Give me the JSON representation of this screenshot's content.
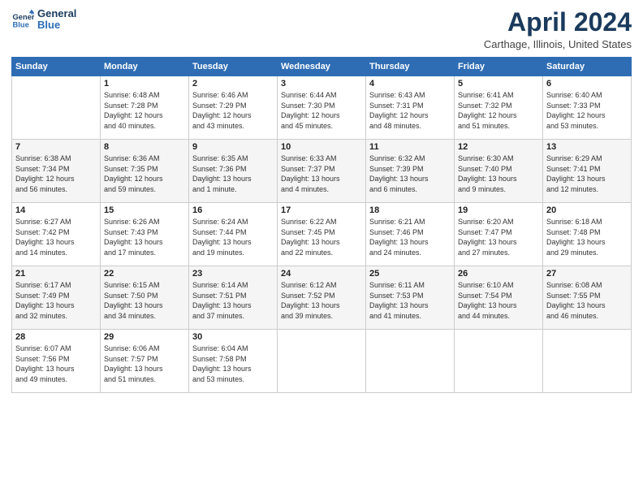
{
  "header": {
    "logo_line1": "General",
    "logo_line2": "Blue",
    "title": "April 2024",
    "subtitle": "Carthage, Illinois, United States"
  },
  "columns": [
    "Sunday",
    "Monday",
    "Tuesday",
    "Wednesday",
    "Thursday",
    "Friday",
    "Saturday"
  ],
  "weeks": [
    [
      {
        "day": "",
        "info": ""
      },
      {
        "day": "1",
        "info": "Sunrise: 6:48 AM\nSunset: 7:28 PM\nDaylight: 12 hours\nand 40 minutes."
      },
      {
        "day": "2",
        "info": "Sunrise: 6:46 AM\nSunset: 7:29 PM\nDaylight: 12 hours\nand 43 minutes."
      },
      {
        "day": "3",
        "info": "Sunrise: 6:44 AM\nSunset: 7:30 PM\nDaylight: 12 hours\nand 45 minutes."
      },
      {
        "day": "4",
        "info": "Sunrise: 6:43 AM\nSunset: 7:31 PM\nDaylight: 12 hours\nand 48 minutes."
      },
      {
        "day": "5",
        "info": "Sunrise: 6:41 AM\nSunset: 7:32 PM\nDaylight: 12 hours\nand 51 minutes."
      },
      {
        "day": "6",
        "info": "Sunrise: 6:40 AM\nSunset: 7:33 PM\nDaylight: 12 hours\nand 53 minutes."
      }
    ],
    [
      {
        "day": "7",
        "info": "Sunrise: 6:38 AM\nSunset: 7:34 PM\nDaylight: 12 hours\nand 56 minutes."
      },
      {
        "day": "8",
        "info": "Sunrise: 6:36 AM\nSunset: 7:35 PM\nDaylight: 12 hours\nand 59 minutes."
      },
      {
        "day": "9",
        "info": "Sunrise: 6:35 AM\nSunset: 7:36 PM\nDaylight: 13 hours\nand 1 minute."
      },
      {
        "day": "10",
        "info": "Sunrise: 6:33 AM\nSunset: 7:37 PM\nDaylight: 13 hours\nand 4 minutes."
      },
      {
        "day": "11",
        "info": "Sunrise: 6:32 AM\nSunset: 7:39 PM\nDaylight: 13 hours\nand 6 minutes."
      },
      {
        "day": "12",
        "info": "Sunrise: 6:30 AM\nSunset: 7:40 PM\nDaylight: 13 hours\nand 9 minutes."
      },
      {
        "day": "13",
        "info": "Sunrise: 6:29 AM\nSunset: 7:41 PM\nDaylight: 13 hours\nand 12 minutes."
      }
    ],
    [
      {
        "day": "14",
        "info": "Sunrise: 6:27 AM\nSunset: 7:42 PM\nDaylight: 13 hours\nand 14 minutes."
      },
      {
        "day": "15",
        "info": "Sunrise: 6:26 AM\nSunset: 7:43 PM\nDaylight: 13 hours\nand 17 minutes."
      },
      {
        "day": "16",
        "info": "Sunrise: 6:24 AM\nSunset: 7:44 PM\nDaylight: 13 hours\nand 19 minutes."
      },
      {
        "day": "17",
        "info": "Sunrise: 6:22 AM\nSunset: 7:45 PM\nDaylight: 13 hours\nand 22 minutes."
      },
      {
        "day": "18",
        "info": "Sunrise: 6:21 AM\nSunset: 7:46 PM\nDaylight: 13 hours\nand 24 minutes."
      },
      {
        "day": "19",
        "info": "Sunrise: 6:20 AM\nSunset: 7:47 PM\nDaylight: 13 hours\nand 27 minutes."
      },
      {
        "day": "20",
        "info": "Sunrise: 6:18 AM\nSunset: 7:48 PM\nDaylight: 13 hours\nand 29 minutes."
      }
    ],
    [
      {
        "day": "21",
        "info": "Sunrise: 6:17 AM\nSunset: 7:49 PM\nDaylight: 13 hours\nand 32 minutes."
      },
      {
        "day": "22",
        "info": "Sunrise: 6:15 AM\nSunset: 7:50 PM\nDaylight: 13 hours\nand 34 minutes."
      },
      {
        "day": "23",
        "info": "Sunrise: 6:14 AM\nSunset: 7:51 PM\nDaylight: 13 hours\nand 37 minutes."
      },
      {
        "day": "24",
        "info": "Sunrise: 6:12 AM\nSunset: 7:52 PM\nDaylight: 13 hours\nand 39 minutes."
      },
      {
        "day": "25",
        "info": "Sunrise: 6:11 AM\nSunset: 7:53 PM\nDaylight: 13 hours\nand 41 minutes."
      },
      {
        "day": "26",
        "info": "Sunrise: 6:10 AM\nSunset: 7:54 PM\nDaylight: 13 hours\nand 44 minutes."
      },
      {
        "day": "27",
        "info": "Sunrise: 6:08 AM\nSunset: 7:55 PM\nDaylight: 13 hours\nand 46 minutes."
      }
    ],
    [
      {
        "day": "28",
        "info": "Sunrise: 6:07 AM\nSunset: 7:56 PM\nDaylight: 13 hours\nand 49 minutes."
      },
      {
        "day": "29",
        "info": "Sunrise: 6:06 AM\nSunset: 7:57 PM\nDaylight: 13 hours\nand 51 minutes."
      },
      {
        "day": "30",
        "info": "Sunrise: 6:04 AM\nSunset: 7:58 PM\nDaylight: 13 hours\nand 53 minutes."
      },
      {
        "day": "",
        "info": ""
      },
      {
        "day": "",
        "info": ""
      },
      {
        "day": "",
        "info": ""
      },
      {
        "day": "",
        "info": ""
      }
    ]
  ]
}
